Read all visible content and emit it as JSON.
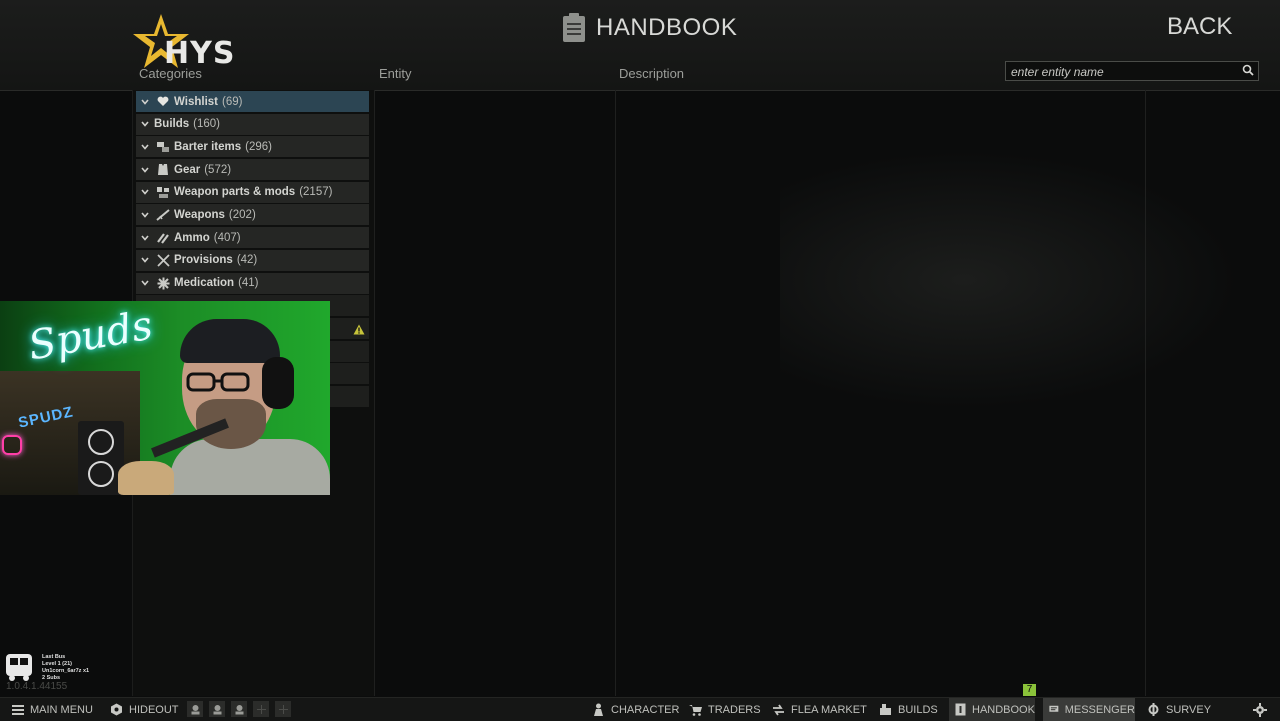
{
  "header": {
    "logo_text": "HYS",
    "title": "HANDBOOK",
    "back_label": "BACK",
    "columns": {
      "categories": "Categories",
      "entity": "Entity",
      "description": "Description"
    },
    "search_placeholder": "enter entity name"
  },
  "categories": [
    {
      "name": "Wishlist",
      "count": "(69)",
      "icon": "heart-icon",
      "active": true
    },
    {
      "name": "Builds",
      "count": "(160)",
      "icon": "",
      "active": false
    },
    {
      "name": "Barter items",
      "count": "(296)",
      "icon": "barter-icon",
      "active": false
    },
    {
      "name": "Gear",
      "count": "(572)",
      "icon": "gear-vest-icon",
      "active": false
    },
    {
      "name": "Weapon parts & mods",
      "count": "(2157)",
      "icon": "weapon-parts-icon",
      "active": false
    },
    {
      "name": "Weapons",
      "count": "(202)",
      "icon": "rifle-icon",
      "active": false
    },
    {
      "name": "Ammo",
      "count": "(407)",
      "icon": "ammo-icon",
      "active": false
    },
    {
      "name": "Provisions",
      "count": "(42)",
      "icon": "provisions-icon",
      "active": false
    },
    {
      "name": "Medication",
      "count": "(41)",
      "icon": "medication-icon",
      "active": false
    }
  ],
  "webcam": {
    "neon_sign": "Spuds",
    "shelf_sign": "SPUDZ"
  },
  "stream_widget": {
    "lines": [
      "Last Bus",
      "Level 1 (21)",
      "Un1corn_6ar7z x1",
      "2 Subs"
    ]
  },
  "version": "1.0.4.1.44155",
  "taskbar": {
    "main_menu": "MAIN MENU",
    "hideout": "HIDEOUT",
    "character": "CHARACTER",
    "traders": "TRADERS",
    "flea_market": "FLEA MARKET",
    "builds": "BUILDS",
    "handbook": "HANDBOOK",
    "messenger": "MESSENGER",
    "survey": "SURVEY",
    "messenger_badge": "7"
  },
  "colors": {
    "active_category": "#2c4553",
    "badge": "#8bc33a",
    "logo_star": "#e8b830",
    "warning": "#c7c43a"
  }
}
